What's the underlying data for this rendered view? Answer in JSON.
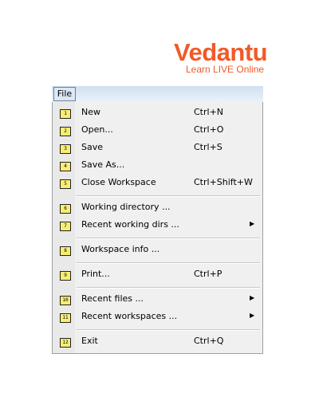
{
  "logo": {
    "brand": "Vedantu",
    "tagline": "Learn LIVE Online"
  },
  "menubar": {
    "file_label": "File"
  },
  "menu": {
    "items": [
      {
        "key": "1",
        "label": "New",
        "shortcut": "Ctrl+N"
      },
      {
        "key": "2",
        "label": "Open...",
        "shortcut": "Ctrl+O"
      },
      {
        "key": "3",
        "label": "Save",
        "shortcut": "Ctrl+S"
      },
      {
        "key": "4",
        "label": "Save As...",
        "shortcut": ""
      },
      {
        "key": "5",
        "label": "Close Workspace",
        "shortcut": "Ctrl+Shift+W"
      },
      {
        "key": "6",
        "label": "Working directory ...",
        "shortcut": ""
      },
      {
        "key": "7",
        "label": "Recent working dirs ...",
        "shortcut": ""
      },
      {
        "key": "8",
        "label": "Workspace info ...",
        "shortcut": ""
      },
      {
        "key": "9",
        "label": "Print...",
        "shortcut": "Ctrl+P"
      },
      {
        "key": "10",
        "label": "Recent files ...",
        "shortcut": ""
      },
      {
        "key": "11",
        "label": "Recent workspaces ...",
        "shortcut": ""
      },
      {
        "key": "12",
        "label": "Exit",
        "shortcut": "Ctrl+Q"
      }
    ]
  },
  "colors": {
    "brand": "#f05a28",
    "key_badge": "#f7ee71",
    "menubar": "#cfdff0"
  }
}
